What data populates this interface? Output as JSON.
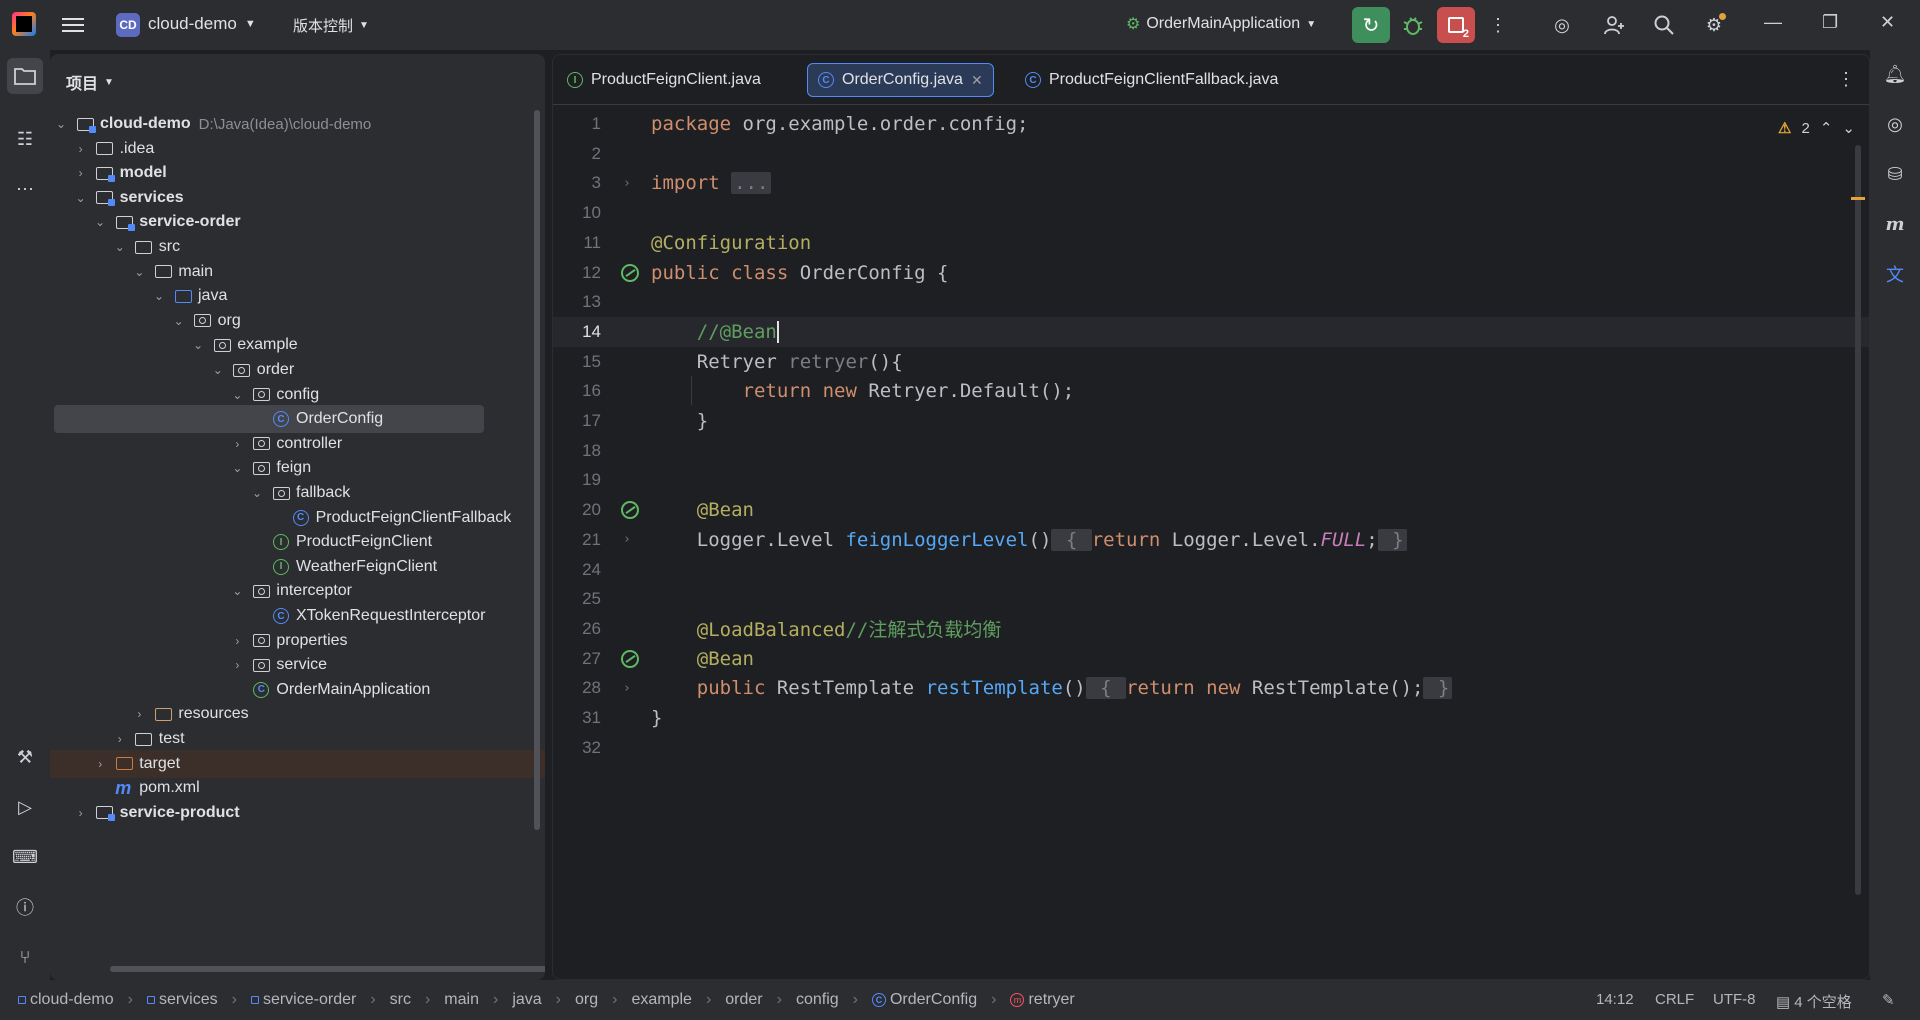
{
  "topbar": {
    "project_badge": "CD",
    "project_name": "cloud-demo",
    "vcs_label": "版本控制",
    "run_config": "OrderMainApplication",
    "stop_badge": "2"
  },
  "project_panel": {
    "title": "项目",
    "tree": [
      {
        "label": "cloud-demo",
        "path": "D:\\Java(Idea)\\cloud-demo",
        "depth": 0,
        "expanded": true,
        "icon": "module-folder",
        "bold": true
      },
      {
        "label": ".idea",
        "depth": 1,
        "expanded": false,
        "icon": "folder"
      },
      {
        "label": "model",
        "depth": 1,
        "expanded": false,
        "icon": "module-folder",
        "bold": true
      },
      {
        "label": "services",
        "depth": 1,
        "expanded": true,
        "icon": "module-folder",
        "bold": true
      },
      {
        "label": "service-order",
        "depth": 2,
        "expanded": true,
        "icon": "module-folder",
        "bold": true
      },
      {
        "label": "src",
        "depth": 3,
        "expanded": true,
        "icon": "folder"
      },
      {
        "label": "main",
        "depth": 4,
        "expanded": true,
        "icon": "folder"
      },
      {
        "label": "java",
        "depth": 5,
        "expanded": true,
        "icon": "source-folder"
      },
      {
        "label": "org",
        "depth": 6,
        "expanded": true,
        "icon": "package"
      },
      {
        "label": "example",
        "depth": 7,
        "expanded": true,
        "icon": "package"
      },
      {
        "label": "order",
        "depth": 8,
        "expanded": true,
        "icon": "package"
      },
      {
        "label": "config",
        "depth": 9,
        "expanded": true,
        "icon": "package"
      },
      {
        "label": "OrderConfig",
        "depth": 10,
        "icon": "class",
        "selected": true
      },
      {
        "label": "controller",
        "depth": 9,
        "expanded": false,
        "icon": "package"
      },
      {
        "label": "feign",
        "depth": 9,
        "expanded": true,
        "icon": "package"
      },
      {
        "label": "fallback",
        "depth": 10,
        "expanded": true,
        "icon": "package"
      },
      {
        "label": "ProductFeignClientFallback",
        "depth": 11,
        "icon": "class"
      },
      {
        "label": "ProductFeignClient",
        "depth": 10,
        "icon": "interface"
      },
      {
        "label": "WeatherFeignClient",
        "depth": 10,
        "icon": "interface"
      },
      {
        "label": "interceptor",
        "depth": 9,
        "expanded": true,
        "icon": "package"
      },
      {
        "label": "XTokenRequestInterceptor",
        "depth": 10,
        "icon": "class"
      },
      {
        "label": "properties",
        "depth": 9,
        "expanded": false,
        "icon": "package"
      },
      {
        "label": "service",
        "depth": 9,
        "expanded": false,
        "icon": "package"
      },
      {
        "label": "OrderMainApplication",
        "depth": 9,
        "icon": "spring-class"
      },
      {
        "label": "resources",
        "depth": 4,
        "expanded": false,
        "icon": "resources-folder"
      },
      {
        "label": "test",
        "depth": 3,
        "expanded": false,
        "icon": "folder"
      },
      {
        "label": "target",
        "depth": 2,
        "expanded": false,
        "icon": "excluded-folder"
      },
      {
        "label": "pom.xml",
        "depth": 2,
        "icon": "maven-file"
      },
      {
        "label": "service-product",
        "depth": 1,
        "expanded": false,
        "icon": "module-folder",
        "bold": true
      }
    ]
  },
  "editor": {
    "tabs": [
      {
        "label": "ProductFeignClient.java",
        "icon": "interface",
        "active": false
      },
      {
        "label": "OrderConfig.java",
        "icon": "class",
        "active": true
      },
      {
        "label": "ProductFeignClientFallback.java",
        "icon": "class",
        "active": false
      }
    ],
    "warning_count": "2",
    "lines": [
      {
        "n": "1",
        "html": "<span class='kw'>package</span> org.example.order.config;"
      },
      {
        "n": "2",
        "html": ""
      },
      {
        "n": "3",
        "html": "<span class='kw'>import</span> <span class='fold'>...</span>",
        "fold": true
      },
      {
        "n": "10",
        "html": ""
      },
      {
        "n": "11",
        "html": "<span class='ann'>@Configuration</span>"
      },
      {
        "n": "12",
        "html": "<span class='kw'>public class</span> OrderConfig {",
        "gutter": "bean"
      },
      {
        "n": "13",
        "html": ""
      },
      {
        "n": "14",
        "html": "    <span class='cmtg'>//@Bean</span><span class='caret'></span>",
        "current": true
      },
      {
        "n": "15",
        "html": "    Retryer <span class='gray'>retryer</span>(){"
      },
      {
        "n": "16",
        "html": "        <span class='kw'>return new</span> Retryer.Default();"
      },
      {
        "n": "17",
        "html": "    }"
      },
      {
        "n": "18",
        "html": ""
      },
      {
        "n": "19",
        "html": ""
      },
      {
        "n": "20",
        "html": "    <span class='ann'>@Bean</span>",
        "gutter": "bean"
      },
      {
        "n": "21",
        "html": "    Logger.Level <span class='fn'>feignLoggerLevel</span>()<span class='fold'> { </span><span class='kw'>return</span> Logger.Level.<span class='ital'>FULL</span>;<span class='fold'> }</span>",
        "fold": true
      },
      {
        "n": "24",
        "html": ""
      },
      {
        "n": "25",
        "html": ""
      },
      {
        "n": "26",
        "html": "    <span class='ann'>@LoadBalanced</span><span class='cmtg'>//注解式负载均衡</span>"
      },
      {
        "n": "27",
        "html": "    <span class='ann'>@Bean</span>",
        "gutter": "bean"
      },
      {
        "n": "28",
        "html": "    <span class='kw'>public</span> RestTemplate <span class='fn'>restTemplate</span>()<span class='fold'> { </span><span class='kw'>return new</span> RestTemplate();<span class='fold'> }</span>",
        "fold": true
      },
      {
        "n": "31",
        "html": "}"
      },
      {
        "n": "32",
        "html": ""
      }
    ]
  },
  "statusbar": {
    "breadcrumbs": [
      "cloud-demo",
      "services",
      "service-order",
      "src",
      "main",
      "java",
      "org",
      "example",
      "order",
      "config",
      "OrderConfig",
      "retryer"
    ],
    "position": "14:12",
    "line_sep": "CRLF",
    "encoding": "UTF-8",
    "indent": "4 个空格"
  },
  "colors": {
    "background": "#1e1f22",
    "panel": "#2b2d30",
    "accent": "#548af7",
    "run_green": "#3f8f5c",
    "stop_red": "#c94f4f"
  }
}
